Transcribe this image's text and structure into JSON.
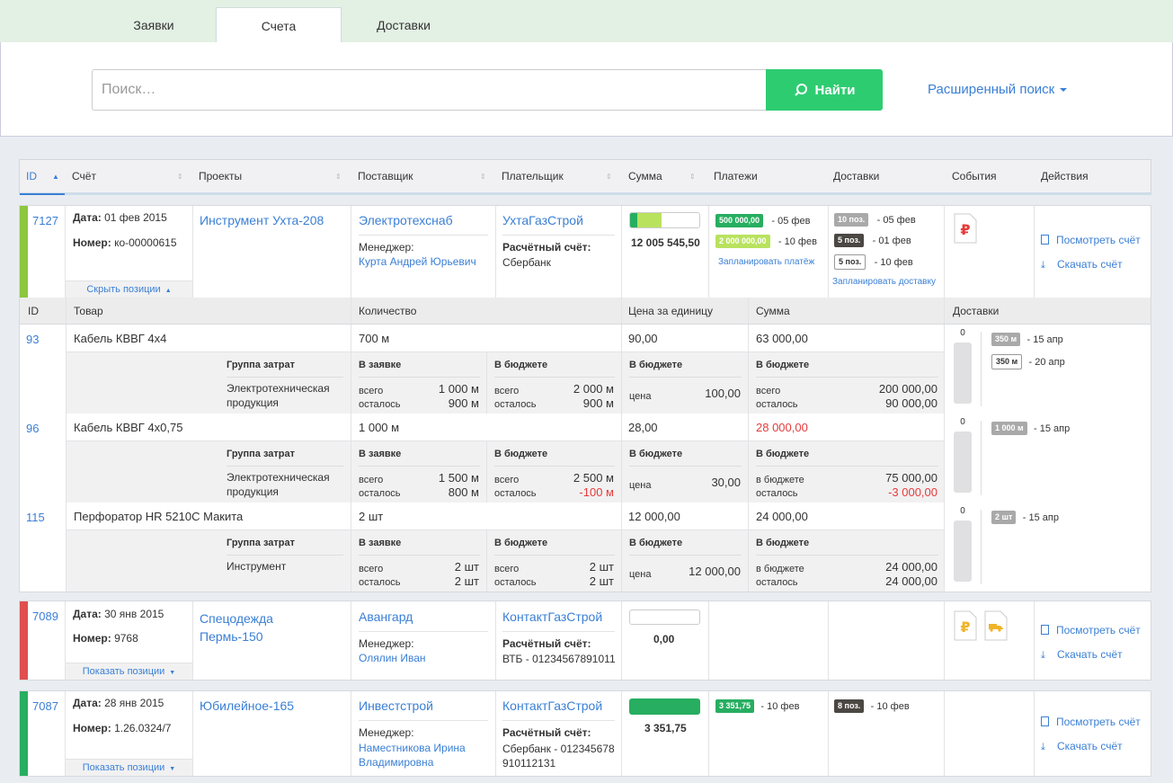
{
  "tabs": [
    "Заявки",
    "Счета",
    "Доставки"
  ],
  "search": {
    "placeholder": "Поиск…",
    "button": "Найти",
    "advanced": "Расширенный поиск"
  },
  "columns": [
    "ID",
    "Счёт",
    "Проекты",
    "Поставщик",
    "Плательщик",
    "Сумма",
    "Платежи",
    "Доставки",
    "События",
    "Действия"
  ],
  "labels": {
    "date": "Дата:",
    "number": "Номер:",
    "manager": "Менеджер:",
    "account": "Расчётный счёт:",
    "view": "Посмотреть счёт",
    "download": "Скачать счёт",
    "plan_pay": "Запланировать платёж",
    "plan_del": "Запланировать доставку",
    "hide_pos": "Скрыть позиции",
    "show_pos": "Показать позиции"
  },
  "invoices": [
    {
      "id": "7127",
      "date": "01 фев 2015",
      "number": "ко-00000615",
      "project": "Инструмент Ухта-208",
      "supplier": "Электротехснаб",
      "manager": "Курта Андрей Юрьевич",
      "payer": "УхтаГазСтрой",
      "account": "Сбербанк",
      "sum": "12 005 545,50",
      "progress": 0.45,
      "payments": [
        {
          "amount": "500 000,00",
          "date": "- 05 фев"
        },
        {
          "amount": "2 000 000,00",
          "date": "- 10 фев"
        }
      ],
      "deliveries": [
        {
          "label": "10 поз.",
          "date": "- 05 фев"
        },
        {
          "label": "5 поз.",
          "date": "- 01 фев"
        },
        {
          "label": "5 поз.",
          "date": "- 10 фев"
        }
      ],
      "color": "#8dc63f"
    },
    {
      "id": "7089",
      "date": "30 янв 2015",
      "number": "9768",
      "project": "Спецодежда Пермь-150",
      "supplier": "Авангард",
      "manager": "Оляли­н Иван",
      "payer": "КонтактГазСтрой",
      "account": "ВТБ - 01234567891011",
      "sum": "0,00",
      "progress": 0,
      "color": "#e04e4e"
    },
    {
      "id": "7087",
      "date": "28 янв 2015",
      "number": "1.26.0324/7",
      "project": "Юбилейное-165",
      "supplier": "Инвестстрой",
      "manager": "Наместникова Ирина Владимировна",
      "payer": "КонтактГазСтрой",
      "account": "Сбербанк - 012345678910112131",
      "sum": "3 351,75",
      "progress": 1,
      "payments": [
        {
          "amount": "3 351,75",
          "date": "- 10 фев"
        }
      ],
      "deliveries": [
        {
          "label": "8 поз.",
          "date": "- 10 фев"
        }
      ],
      "color": "#27ae60"
    }
  ],
  "items_header": [
    "ID",
    "Товар",
    "Количество",
    "Цена за единицу",
    "Сумма",
    "Доставки"
  ],
  "items": [
    {
      "id": "93",
      "name": "Кабель КВВГ 4х4",
      "qty": "700 м",
      "price": "90,00",
      "sum": "63 000,00",
      "cost_group": "Электротехническая продукция",
      "req_total": "1 000 м",
      "req_left": "900 м",
      "bud_total": "2 000 м",
      "bud_left": "900 м",
      "price_budget": "100,00",
      "sum_l1": "всего",
      "sum_v1": "200 000,00",
      "sum_l2": "осталось",
      "sum_v2": "90 000,00",
      "del_count": "0",
      "deliveries": [
        {
          "label": "350 м",
          "date": "- 15 апр"
        },
        {
          "label": "350 м",
          "date": "- 20 апр"
        }
      ]
    },
    {
      "id": "96",
      "name": "Кабель КВВГ 4х0,75",
      "qty": "1 000 м",
      "price": "28,00",
      "sum": "28 000,00",
      "cost_group": "Электротехническая продукция",
      "req_total": "1 500 м",
      "req_left": "800 м",
      "bud_total": "2 500 м",
      "bud_left": "-100 м",
      "price_budget": "30,00",
      "sum_l1": "в бюджете",
      "sum_v1": "75 000,00",
      "sum_l2": "осталось",
      "sum_v2": "-3 000,00",
      "del_count": "0",
      "deliveries": [
        {
          "label": "1 000 м",
          "date": "- 15 апр"
        }
      ]
    },
    {
      "id": "115",
      "name": "Перфоратор HR 5210С Макита",
      "qty": "2 шт",
      "price": "12 000,00",
      "sum": "24 000,00",
      "cost_group": "Инструмент",
      "req_total": "2  шт",
      "req_left": "2  шт",
      "bud_total": "2  шт",
      "bud_left": "2  шт",
      "price_budget": "12 000,00",
      "sum_l1": "в бюджете",
      "sum_v1": "24 000,00",
      "sum_l2": "осталось",
      "sum_v2": "24 000,00",
      "del_count": "0",
      "deliveries": [
        {
          "label": "2 шт",
          "date": "- 15 апр"
        }
      ]
    }
  ],
  "item_sub": {
    "cost_group": "Группа затрат",
    "in_request": "В заявке",
    "in_budget": "В бюджете",
    "total": "всего",
    "left": "осталось",
    "price": "цена"
  }
}
